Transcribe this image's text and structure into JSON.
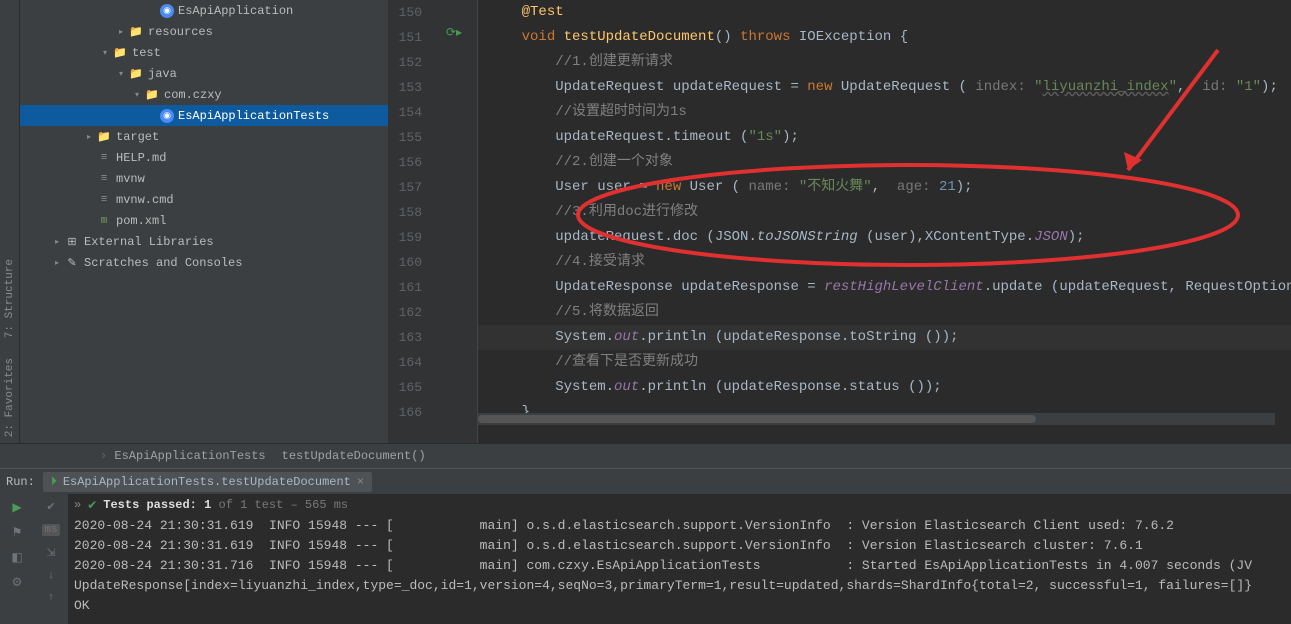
{
  "tree": [
    {
      "d": 6,
      "a": "",
      "i": "java",
      "t": "EsApiApplication"
    },
    {
      "d": 4,
      "a": "r",
      "i": "dir",
      "t": "resources"
    },
    {
      "d": 3,
      "a": "d",
      "i": "dir",
      "t": "test"
    },
    {
      "d": 4,
      "a": "d",
      "i": "dir",
      "t": "java"
    },
    {
      "d": 5,
      "a": "d",
      "i": "dir",
      "t": "com.czxy"
    },
    {
      "d": 6,
      "a": "",
      "i": "java",
      "t": "EsApiApplicationTests",
      "sel": true
    },
    {
      "d": 2,
      "a": "r",
      "i": "dir",
      "t": "target"
    },
    {
      "d": 2,
      "a": "",
      "i": "file",
      "t": "HELP.md"
    },
    {
      "d": 2,
      "a": "",
      "i": "file",
      "t": "mvnw"
    },
    {
      "d": 2,
      "a": "",
      "i": "file",
      "t": "mvnw.cmd"
    },
    {
      "d": 2,
      "a": "",
      "i": "m",
      "t": "pom.xml"
    },
    {
      "d": 0,
      "a": "r",
      "i": "lib",
      "t": "External Libraries"
    },
    {
      "d": 0,
      "a": "r",
      "i": "scr",
      "t": "Scratches and Consoles"
    }
  ],
  "lines": {
    "start": 150,
    "current": 163,
    "code": [
      "    <span class='fn'>@Test</span>",
      "    <span class='kw'>void</span> <span class='fn'>testUpdateDocument</span>() <span class='kw'>throws</span> IOException {",
      "        <span class='cmt'>//1.创建更新请求</span>",
      "        UpdateRequest updateRequest = <span class='kw'>new</span> UpdateRequest ( <span class='param'>index:</span> <span class='str'>\"<span class='ul'>liyuanzhi_index</span>\"</span>,  <span class='param'>id:</span> <span class='str'>\"1\"</span>);",
      "        <span class='cmt'>//设置超时时间为1s</span>",
      "        updateRequest.timeout (<span class='str'>\"1s\"</span>);",
      "        <span class='cmt'>//2.创建一个对象</span>",
      "        User user = <span class='kw'>new</span> User ( <span class='param'>name:</span> <span class='str'>\"不知火舞\"</span>,  <span class='param'>age:</span> <span class='num'>21</span>);",
      "        <span class='cmt'>//3.利用doc进行修改</span>",
      "        updateRequest.doc (JSON.<span class='ital'>toJSONString</span> (user),XContentType.<span class='fld'>JSON</span>);",
      "        <span class='cmt'>//4.接受请求</span>",
      "        UpdateResponse updateResponse = <span class='fld'>restHighLevelClient</span>.update (updateRequest, RequestOptions.<span class='fld'>DEF</span>",
      "        <span class='cmt'>//5.将数据返回</span>",
      "        System.<span class='fld'>out</span>.println (updateResponse.toString ());",
      "        <span class='cmt'>//查看下是否更新成功</span>",
      "        System.<span class='fld'>out</span>.println (updateResponse.status ());",
      "    }"
    ]
  },
  "breadcrumb": [
    "EsApiApplicationTests",
    "testUpdateDocument()"
  ],
  "run": {
    "label": "Run:",
    "tab": "EsApiApplicationTests.testUpdateDocument",
    "pass": "Tests passed: 1",
    "of": " of 1 test",
    "time": " – 565 ms",
    "ms": "ms"
  },
  "console": [
    "2020-08-24 21:30:31.619  INFO 15948 --- [           main] o.s.d.elasticsearch.support.VersionInfo  : Version Elasticsearch Client used: 7.6.2",
    "2020-08-24 21:30:31.619  INFO 15948 --- [           main] o.s.d.elasticsearch.support.VersionInfo  : Version Elasticsearch cluster: 7.6.1",
    "2020-08-24 21:30:31.716  INFO 15948 --- [           main] com.czxy.EsApiApplicationTests           : Started EsApiApplicationTests in 4.007 seconds (JV",
    "UpdateResponse[index=liyuanzhi_index,type=_doc,id=1,version=4,seqNo=3,primaryTerm=1,result=updated,shards=ShardInfo{total=2, successful=1, failures=[]}",
    "OK"
  ],
  "sidetabs": [
    "2: Favorites",
    "7: Structure"
  ]
}
